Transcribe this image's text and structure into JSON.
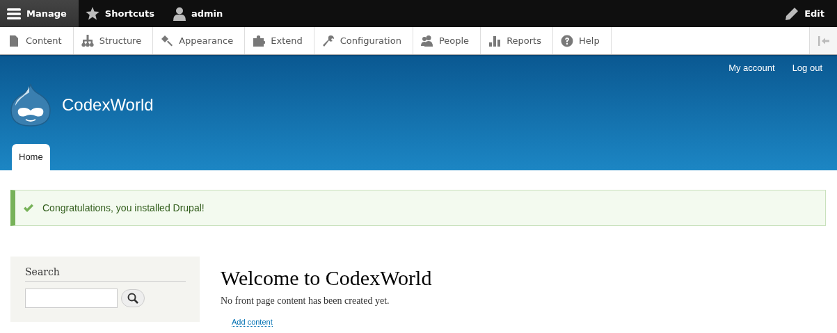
{
  "toolbar": {
    "items": [
      {
        "label": "Manage",
        "selected": true
      },
      {
        "label": "Shortcuts",
        "selected": false
      },
      {
        "label": "admin",
        "selected": false
      }
    ],
    "edit": "Edit"
  },
  "tray": {
    "items": [
      "Content",
      "Structure",
      "Appearance",
      "Extend",
      "Configuration",
      "People",
      "Reports",
      "Help"
    ]
  },
  "header": {
    "links": [
      "My account",
      "Log out"
    ],
    "site_name": "CodexWorld",
    "tabs": [
      {
        "label": "Home",
        "selected": true
      }
    ]
  },
  "message": {
    "text": "Congratulations, you installed Drupal!"
  },
  "sidebar": {
    "title": "Search"
  },
  "main": {
    "title": "Welcome to CodexWorld",
    "text": "No front page content has been created yet.",
    "link": "Add content"
  }
}
